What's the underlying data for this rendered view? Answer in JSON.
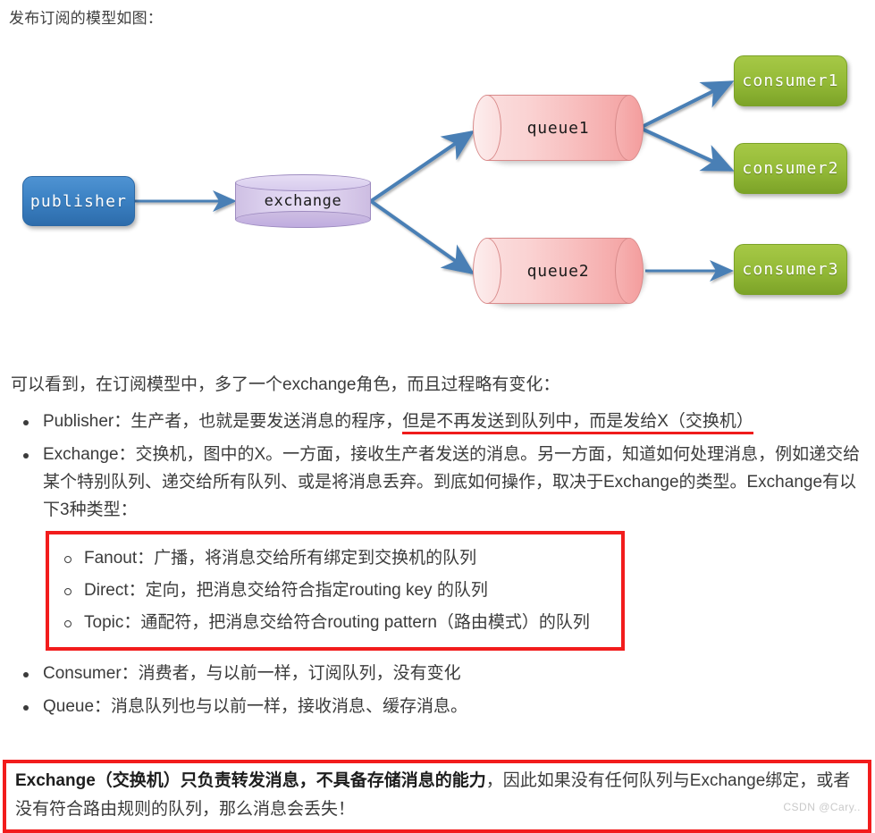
{
  "intro": {
    "text": "发布订阅的模型如图："
  },
  "diagram": {
    "title": "publish-subscribe-model",
    "nodes": {
      "publisher": {
        "label": "publisher",
        "shape": "rounded-rect",
        "color": "#3c82c4"
      },
      "exchange": {
        "label": "exchange",
        "shape": "cylinder",
        "color": "#ddd2ef"
      },
      "queue1": {
        "label": "queue1",
        "shape": "cylinder-horizontal",
        "color": "#f7b9b9"
      },
      "queue2": {
        "label": "queue2",
        "shape": "cylinder-horizontal",
        "color": "#f7b9b9"
      },
      "consumer1": {
        "label": "consumer1",
        "shape": "rounded-rect",
        "color": "#95bb38"
      },
      "consumer2": {
        "label": "consumer2",
        "shape": "rounded-rect",
        "color": "#95bb38"
      },
      "consumer3": {
        "label": "consumer3",
        "shape": "rounded-rect",
        "color": "#95bb38"
      }
    },
    "edges": [
      {
        "from": "publisher",
        "to": "exchange"
      },
      {
        "from": "exchange",
        "to": "queue1"
      },
      {
        "from": "exchange",
        "to": "queue2"
      },
      {
        "from": "queue1",
        "to": "consumer1"
      },
      {
        "from": "queue1",
        "to": "consumer2"
      },
      {
        "from": "queue2",
        "to": "consumer3"
      }
    ],
    "arrow_color": "#4a7fb5"
  },
  "prose": {
    "lead": "可以看到，在订阅模型中，多了一个exchange角色，而且过程略有变化：",
    "bullets": {
      "publisher": {
        "plain": "Publisher：生产者，也就是要发送消息的程序，",
        "underlined": "但是不再发送到队列中，而是发给X（交换机）"
      },
      "exchange": "Exchange：交换机，图中的X。一方面，接收生产者发送的消息。另一方面，知道如何处理消息，例如递交给某个特别队列、递交给所有队列、或是将消息丢弃。到底如何操作，取决于Exchange的类型。Exchange有以下3种类型：",
      "consumer": "Consumer：消费者，与以前一样，订阅队列，没有变化",
      "queue": "Queue：消息队列也与以前一样，接收消息、缓存消息。"
    },
    "exchange_types": [
      "Fanout：广播，将消息交给所有绑定到交换机的队列",
      "Direct：定向，把消息交给符合指定routing key 的队列",
      "Topic：通配符，把消息交给符合routing pattern（路由模式）的队列"
    ]
  },
  "callout": {
    "bold1": "Exchange（交换机）只负责转发消息，不具备存储消息的能力",
    "rest": "，因此如果没有任何队列与Exchange绑定，或者没有符合路由规则的队列，那么消息会丢失！",
    "border_color": "#f21c1c"
  },
  "watermark": {
    "text": "CSDN @Cary.."
  }
}
